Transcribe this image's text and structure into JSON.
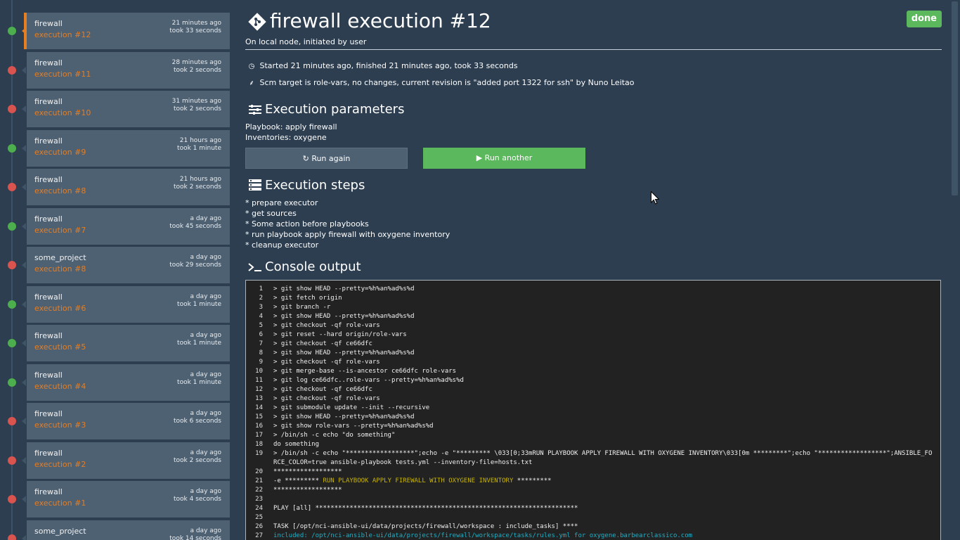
{
  "sidebar": {
    "items": [
      {
        "project": "firewall",
        "execution": "execution #12",
        "when": "21 minutes ago",
        "took": "took 33 seconds",
        "status": "ok",
        "active": true
      },
      {
        "project": "firewall",
        "execution": "execution #11",
        "when": "28 minutes ago",
        "took": "took 2 seconds",
        "status": "fail"
      },
      {
        "project": "firewall",
        "execution": "execution #10",
        "when": "31 minutes ago",
        "took": "took 2 seconds",
        "status": "fail"
      },
      {
        "project": "firewall",
        "execution": "execution #9",
        "when": "21 hours ago",
        "took": "took 1 minute",
        "status": "ok"
      },
      {
        "project": "firewall",
        "execution": "execution #8",
        "when": "21 hours ago",
        "took": "took 2 seconds",
        "status": "fail"
      },
      {
        "project": "firewall",
        "execution": "execution #7",
        "when": "a day ago",
        "took": "took 45 seconds",
        "status": "ok"
      },
      {
        "project": "some_project",
        "execution": "execution #8",
        "when": "a day ago",
        "took": "took 29 seconds",
        "status": "fail"
      },
      {
        "project": "firewall",
        "execution": "execution #6",
        "when": "a day ago",
        "took": "took 1 minute",
        "status": "ok"
      },
      {
        "project": "firewall",
        "execution": "execution #5",
        "when": "a day ago",
        "took": "took 1 minute",
        "status": "ok"
      },
      {
        "project": "firewall",
        "execution": "execution #4",
        "when": "a day ago",
        "took": "took 1 minute",
        "status": "ok"
      },
      {
        "project": "firewall",
        "execution": "execution #3",
        "when": "a day ago",
        "took": "took 6 seconds",
        "status": "fail"
      },
      {
        "project": "firewall",
        "execution": "execution #2",
        "when": "a day ago",
        "took": "took 2 seconds",
        "status": "fail"
      },
      {
        "project": "firewall",
        "execution": "execution #1",
        "when": "a day ago",
        "took": "took 4 seconds",
        "status": "fail"
      },
      {
        "project": "some_project",
        "execution": "",
        "when": "a day ago",
        "took": "took 14 seconds",
        "status": "fail"
      }
    ]
  },
  "header": {
    "title": "firewall execution #12",
    "status": "done",
    "subtitle": "On local node, initiated by user"
  },
  "info": {
    "started": "Started 21 minutes ago, finished 21 minutes ago, took 33 seconds",
    "scm": "Scm target is role-vars, no changes, current revision is \"added port 1322 for ssh\" by Nuno Leitao"
  },
  "params": {
    "heading": "Execution parameters",
    "playbook": "Playbook: apply firewall",
    "inventories": "Inventories: oxygene",
    "run_again": "Run again",
    "run_another": "Run another"
  },
  "steps": {
    "heading": "Execution steps",
    "items": [
      "* prepare executor",
      "* get sources",
      "* Some action before playbooks",
      "* run playbook apply firewall with oxygene inventory",
      "* cleanup executor"
    ]
  },
  "console": {
    "heading": "Console output",
    "lines": [
      {
        "n": "1",
        "t": "> git show HEAD --pretty=%h%an%ad%s%d"
      },
      {
        "n": "2",
        "t": "> git fetch origin"
      },
      {
        "n": "3",
        "t": "> git branch -r"
      },
      {
        "n": "4",
        "t": "> git show HEAD --pretty=%h%an%ad%s%d"
      },
      {
        "n": "5",
        "t": "> git checkout -qf role-vars"
      },
      {
        "n": "6",
        "t": "> git reset --hard origin/role-vars"
      },
      {
        "n": "7",
        "t": "> git checkout -qf ce66dfc"
      },
      {
        "n": "8",
        "t": "> git show HEAD --pretty=%h%an%ad%s%d"
      },
      {
        "n": "9",
        "t": "> git checkout -qf role-vars"
      },
      {
        "n": "10",
        "t": "> git merge-base --is-ancestor ce66dfc role-vars"
      },
      {
        "n": "11",
        "t": "> git log ce66dfc..role-vars --pretty=%h%an%ad%s%d"
      },
      {
        "n": "12",
        "t": "> git checkout -qf ce66dfc"
      },
      {
        "n": "13",
        "t": "> git checkout -qf role-vars"
      },
      {
        "n": "14",
        "t": "> git submodule update --init --recursive"
      },
      {
        "n": "15",
        "t": "> git show HEAD --pretty=%h%an%ad%s%d"
      },
      {
        "n": "16",
        "t": "> git show role-vars --pretty=%h%an%ad%s%d"
      },
      {
        "n": "17",
        "t": "> /bin/sh -c echo \"do something\""
      },
      {
        "n": "18",
        "t": "do something"
      },
      {
        "n": "19",
        "t": "> /bin/sh -c echo \"******************\";echo -e \"********* \\033[0;33mRUN PLAYBOOK APPLY FIREWALL WITH OXYGENE INVENTORY\\033[0m *********\";echo \"******************\";ANSIBLE_FORCE_COLOR=true ansible-playbook tests.yml --inventory-file=hosts.txt"
      },
      {
        "n": "20",
        "t": "******************"
      },
      {
        "n": "21",
        "pre": "-e ********* ",
        "hl": "RUN PLAYBOOK APPLY FIREWALL WITH OXYGENE INVENTORY",
        "post": " *********"
      },
      {
        "n": "22",
        "t": "******************"
      },
      {
        "n": "23",
        "t": ""
      },
      {
        "n": "24",
        "t": "PLAY [all] *********************************************************************"
      },
      {
        "n": "25",
        "t": ""
      },
      {
        "n": "26",
        "t": "TASK [/opt/nci-ansible-ui/data/projects/firewall/workspace : include_tasks] ****"
      },
      {
        "n": "27",
        "cyan": "included: /opt/nci-ansible-ui/data/projects/firewall/workspace/tasks/rules.yml for oxygene.barbearclassico.com"
      }
    ]
  }
}
